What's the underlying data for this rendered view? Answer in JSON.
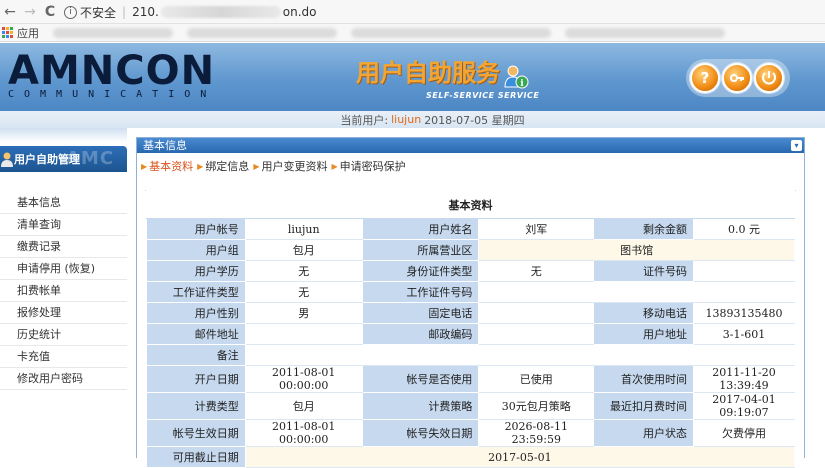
{
  "browser": {
    "back": "←",
    "forward": "→",
    "reload": "C",
    "security_label": "不安全",
    "url_start": "210.",
    "url_end": "on.do",
    "bookmarks_label": "应用"
  },
  "header": {
    "logo": "AMNCON",
    "logo_sub": "COMMUNICATION",
    "service_title": "用户自助服务",
    "service_sub": "SELF-SERVICE SERVICE",
    "help_icon": "?",
    "key_icon": "key-icon",
    "exit_icon": "exit-icon"
  },
  "status": {
    "prefix": "当前用户:",
    "user": "liujun",
    "date": "2018-07-05 星期四"
  },
  "sidebar": {
    "title": "用户自助管理",
    "watermark": "AMC",
    "items": [
      {
        "label": "基本信息"
      },
      {
        "label": "清单查询"
      },
      {
        "label": "缴费记录"
      },
      {
        "label": "申请停用 (恢复)"
      },
      {
        "label": "扣费帐单"
      },
      {
        "label": "报修处理"
      },
      {
        "label": "历史统计"
      },
      {
        "label": "卡充值"
      },
      {
        "label": "修改用户密码"
      }
    ]
  },
  "panel": {
    "title": "基本信息",
    "collapse": "▾",
    "tabs": [
      {
        "label": "基本资料"
      },
      {
        "label": "绑定信息"
      },
      {
        "label": "用户变更资料"
      },
      {
        "label": "申请密码保护"
      }
    ],
    "table_title": "基本资料",
    "rows": [
      [
        {
          "l": "用户帐号"
        },
        {
          "v": "liujun"
        },
        {
          "l": "用户姓名"
        },
        {
          "v": "刘军"
        },
        {
          "l": "剩余金额"
        },
        {
          "v": "0.0 元"
        }
      ],
      [
        {
          "l": "用户组"
        },
        {
          "v": "包月"
        },
        {
          "l": "所属营业区"
        },
        {
          "v": "图书馆",
          "span": 3,
          "hl": true
        }
      ],
      [
        {
          "l": "用户学历"
        },
        {
          "v": "无"
        },
        {
          "l": "身份证件类型"
        },
        {
          "v": "无"
        },
        {
          "l": "证件号码"
        },
        {
          "v": ""
        }
      ],
      [
        {
          "l": "工作证件类型"
        },
        {
          "v": "无"
        },
        {
          "l": "工作证件号码"
        },
        {
          "v": "",
          "span": 3
        }
      ],
      [
        {
          "l": "用户性别"
        },
        {
          "v": "男"
        },
        {
          "l": "固定电话"
        },
        {
          "v": ""
        },
        {
          "l": "移动电话"
        },
        {
          "v": "13893135480"
        }
      ],
      [
        {
          "l": "邮件地址"
        },
        {
          "v": ""
        },
        {
          "l": "邮政编码"
        },
        {
          "v": ""
        },
        {
          "l": "用户地址"
        },
        {
          "v": "3-1-601"
        }
      ],
      [
        {
          "l": "备注"
        },
        {
          "v": "",
          "span": 5
        }
      ],
      [
        {
          "l": "开户日期"
        },
        {
          "v": "2011-08-01 00:00:00"
        },
        {
          "l": "帐号是否使用"
        },
        {
          "v": "已使用"
        },
        {
          "l": "首次使用时间"
        },
        {
          "v": "2011-11-20 13:39:49"
        }
      ],
      [
        {
          "l": "计费类型"
        },
        {
          "v": "包月"
        },
        {
          "l": "计费策略"
        },
        {
          "v": "30元包月策略"
        },
        {
          "l": "最近扣月费时间"
        },
        {
          "v": "2017-04-01 09:19:07"
        }
      ],
      [
        {
          "l": "帐号生效日期"
        },
        {
          "v": "2011-08-01 00:00:00"
        },
        {
          "l": "帐号失效日期"
        },
        {
          "v": "2026-08-11 23:59:59"
        },
        {
          "l": "用户状态"
        },
        {
          "v": "欠费停用"
        }
      ],
      [
        {
          "l": "可用截止日期"
        },
        {
          "v": "2017-05-01",
          "span": 5,
          "hl": true
        }
      ]
    ]
  },
  "colors": {
    "accent_orange": "#f3a533",
    "panel_blue": "#2868b0",
    "label_bg": "#c6d9ef",
    "active_tab": "#d9531e"
  }
}
